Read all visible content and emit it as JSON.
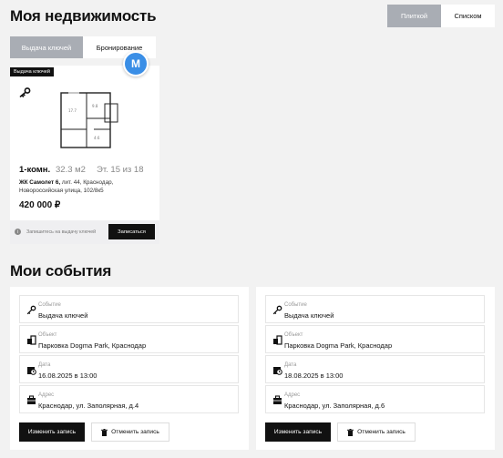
{
  "header": {
    "title": "Моя недвижимость",
    "view_toggle": {
      "tiles_label": "Плиткой",
      "list_label": "Списком",
      "selected": "Плиткой"
    }
  },
  "tabs": {
    "items": [
      "Выдача ключей",
      "Бронирование"
    ],
    "active": "Выдача ключей"
  },
  "avatar": {
    "letter": "M",
    "color": "#3a8ee6"
  },
  "property": {
    "badge": "Выдача ключей",
    "rooms": "1-комн.",
    "area": "32.3 м2",
    "floor": "Эт. 15 из 18",
    "complex": "ЖК Самолет 6,",
    "address": " лит. 44, Краснодар, Новороссийская улица, 102/8к5",
    "price": "420 000 ₽",
    "footer_note": "Запишитесь на выдачу ключей",
    "signup_label": "Записаться",
    "plan_labels": [
      "17.7",
      "9.8",
      "4.6"
    ]
  },
  "events_section": {
    "title": "Мои события"
  },
  "events": [
    {
      "fields": [
        {
          "label": "Событие",
          "value": "Выдача ключей",
          "icon": "key-icon"
        },
        {
          "label": "Объект",
          "value": "Парковка Dogma Park, Краснодар",
          "icon": "building-icon"
        },
        {
          "label": "Дата",
          "value": "16.08.2025 в 13:00",
          "icon": "calendar-clock-icon"
        },
        {
          "label": "Адрес",
          "value": "Краснодар, ул. Заполярная, д.4",
          "icon": "briefcase-icon"
        }
      ],
      "edit_label": "Изменить запись",
      "cancel_label": "Отменить запись"
    },
    {
      "fields": [
        {
          "label": "Событие",
          "value": "Выдача ключей",
          "icon": "key-icon"
        },
        {
          "label": "Объект",
          "value": "Парковка Dogma Park, Краснодар",
          "icon": "building-icon"
        },
        {
          "label": "Дата",
          "value": "18.08.2025 в 13:00",
          "icon": "calendar-clock-icon"
        },
        {
          "label": "Адрес",
          "value": "Краснодар, ул. Заполярная, д.6",
          "icon": "briefcase-icon"
        }
      ],
      "edit_label": "Изменить запись",
      "cancel_label": "Отменить запись"
    }
  ],
  "colors": {
    "background": "#f2f2f2",
    "accent_gray": "#a9adb4",
    "dark": "#111111",
    "avatar_blue": "#3a8ee6"
  }
}
